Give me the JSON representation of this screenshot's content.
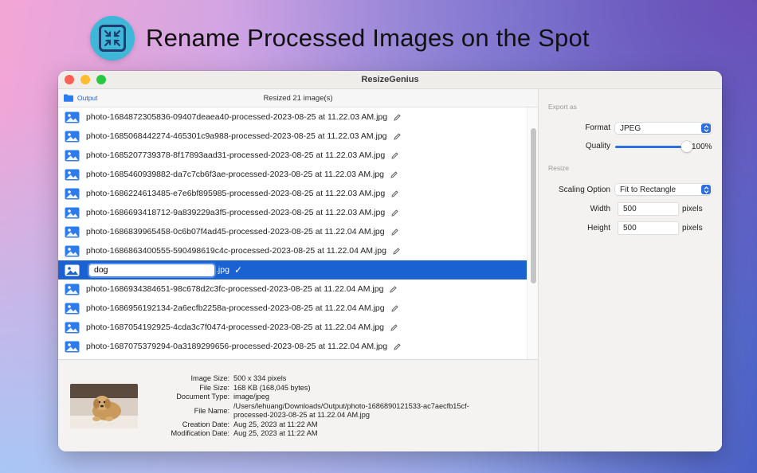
{
  "headline": "Rename Processed Images on the Spot",
  "icons": {
    "app": "compress-arrows-icon",
    "image": "photo-icon",
    "edit": "pencil-icon",
    "folder": "folder-icon",
    "confirm": "checkmark-icon"
  },
  "colors": {
    "accent": "#1a61d2",
    "icon_blue": "#2b7cf0",
    "app_icon_bg": "#3fb7d8"
  },
  "window": {
    "title": "ResizeGenius"
  },
  "toolbar": {
    "output_label": "Output",
    "status": "Resized 21 image(s)"
  },
  "files": {
    "before": [
      "photo-1684872305836-09407deaea40-processed-2023-08-25 at 11.22.03 AM.jpg",
      "photo-1685068442274-465301c9a988-processed-2023-08-25 at 11.22.03 AM.jpg",
      "photo-1685207739378-8f17893aad31-processed-2023-08-25 at 11.22.03 AM.jpg",
      "photo-1685460939882-da7c7cb6f3ae-processed-2023-08-25 at 11.22.03 AM.jpg",
      "photo-1686224613485-e7e6bf895985-processed-2023-08-25 at 11.22.03 AM.jpg",
      "photo-1686693418712-9a839229a3f5-processed-2023-08-25 at 11.22.03 AM.jpg",
      "photo-1686839965458-0c6b07f4ad45-processed-2023-08-25 at 11.22.04 AM.jpg",
      "photo-1686863400555-590498619c4c-processed-2023-08-25 at 11.22.04 AM.jpg"
    ],
    "selected": {
      "value": "dog",
      "ext": ".jpg"
    },
    "after": [
      "photo-1686934384651-98c678d2c3fc-processed-2023-08-25 at 11.22.04 AM.jpg",
      "photo-1686956192134-2a6ecfb2258a-processed-2023-08-25 at 11.22.04 AM.jpg",
      "photo-1687054192925-4cda3c7f0474-processed-2023-08-25 at 11.22.04 AM.jpg",
      "photo-1687075379294-0a3189299656-processed-2023-08-25 at 11.22.04 AM.jpg"
    ]
  },
  "info": {
    "image_size_label": "Image Size:",
    "image_size": "500 x 334 pixels",
    "file_size_label": "File Size:",
    "file_size": "168 KB (168,045 bytes)",
    "doc_type_label": "Document Type:",
    "doc_type": "image/jpeg",
    "file_name_label": "File Name:",
    "file_name_line1": "/Users/lehuang/Downloads/Output/photo-1686890121533-ac7aecfb15cf-",
    "file_name_line2": "processed-2023-08-25 at 11.22.04 AM.jpg",
    "creation_label": "Creation Date:",
    "creation": "Aug 25, 2023 at 11:22 AM",
    "modification_label": "Modification Date:",
    "modification": "Aug 25, 2023 at 11:22 AM"
  },
  "settings": {
    "export_section": "Export as",
    "format_label": "Format",
    "format_value": "JPEG",
    "quality_label": "Quality",
    "quality_value": "100%",
    "quality_fraction": 1.0,
    "resize_section": "Resize",
    "scaling_label": "Scaling Option",
    "scaling_value": "Fit to Rectangle",
    "width_label": "Width",
    "width_value": "500",
    "width_unit": "pixels",
    "height_label": "Height",
    "height_value": "500",
    "height_unit": "pixels"
  }
}
